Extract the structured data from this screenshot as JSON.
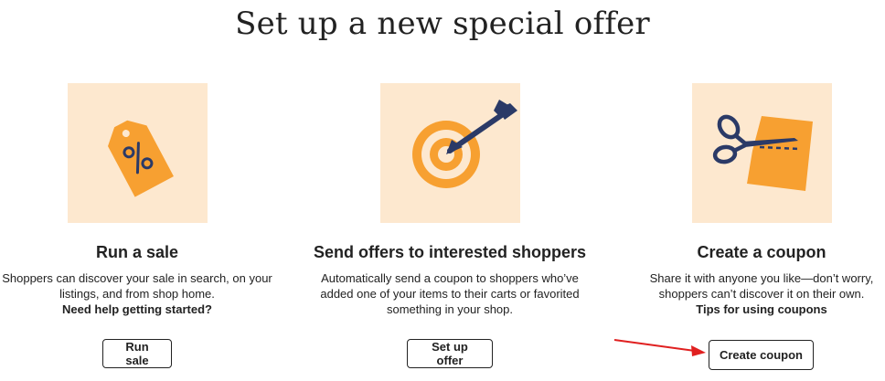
{
  "page": {
    "title": "Set up a new special offer"
  },
  "cards": [
    {
      "icon": "percent-tag-icon",
      "title": "Run a sale",
      "description": "Shoppers can discover your sale in search, on your listings, and from shop home.",
      "link": "Need help getting started?",
      "button": "Run sale"
    },
    {
      "icon": "target-arrow-icon",
      "title": "Send offers to interested shoppers",
      "description": "Automatically send a coupon to shoppers who’ve added one of your items to their carts or favorited something in your shop.",
      "link": "",
      "button": "Set up offer"
    },
    {
      "icon": "scissors-coupon-icon",
      "title": "Create a coupon",
      "description": "Share it with anyone you like—don’t worry, shoppers can’t discover it on their own.",
      "link": "Tips for using coupons",
      "button": "Create coupon"
    }
  ],
  "annotation": {
    "icon": "red-arrow-icon",
    "color": "#e02020"
  },
  "colors": {
    "illustration_bg": "#fde8cf",
    "accent_orange": "#f7a031",
    "accent_navy": "#2b3a67"
  }
}
